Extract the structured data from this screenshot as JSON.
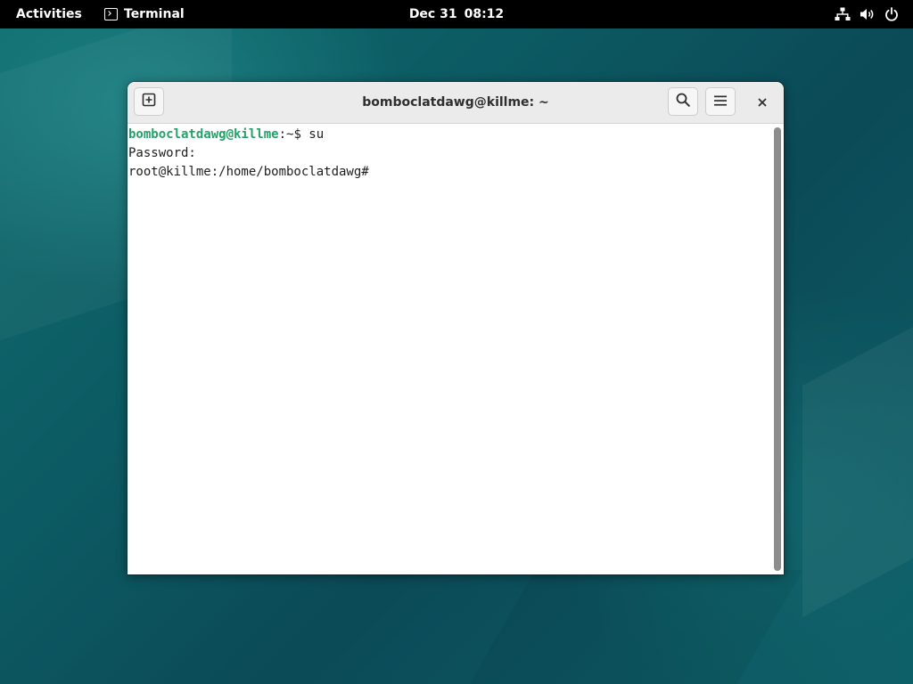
{
  "topbar": {
    "activities_label": "Activities",
    "app_name": "Terminal",
    "date": "Dec 31",
    "time": "08:12",
    "icons": [
      "network-icon",
      "volume-icon",
      "power-icon"
    ]
  },
  "window": {
    "title": "bomboclatdawg@killme: ~",
    "buttons": [
      "new-tab-icon",
      "search-icon",
      "hamburger-menu-icon",
      "close-icon"
    ]
  },
  "terminal": {
    "lines": [
      {
        "user_host": "bomboclatdawg@killme",
        "separator": ":",
        "path_and_cmd": "~$ su"
      },
      {
        "text": "Password:"
      },
      {
        "text": "root@killme:/home/bomboclatdawg#"
      }
    ]
  },
  "colors": {
    "topbar_bg": "#000000",
    "headerbar_bg": "#ebebeb",
    "prompt_user": "#26a269",
    "terminal_bg": "#ffffff",
    "terminal_text": "#1e1e1e",
    "scrollbar": "#8d8d8d"
  }
}
